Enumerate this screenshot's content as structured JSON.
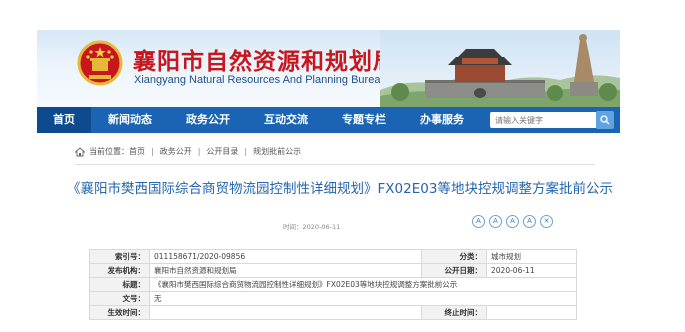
{
  "header": {
    "title": "襄阳市自然资源和规划局",
    "subtitle": "Xiangyang Natural Resources And Planning Bureau"
  },
  "nav": {
    "items": [
      {
        "label": "首页"
      },
      {
        "label": "新闻动态"
      },
      {
        "label": "政务公开"
      },
      {
        "label": "互动交流"
      },
      {
        "label": "专题专栏"
      },
      {
        "label": "办事服务"
      }
    ],
    "search_placeholder": "请输入关键字"
  },
  "breadcrumb": {
    "prefix": "当前位置：",
    "items": [
      "首页",
      "政务公开",
      "公开目录",
      "规划批前公示"
    ]
  },
  "article": {
    "title": "《襄阳市樊西国际综合商贸物流园控制性详细规划》FX02E03等地块控规调整方案批前公示",
    "date": "时间：2020-06-11",
    "tools": [
      "A",
      "A",
      "A",
      "A",
      "✕"
    ]
  },
  "info_table": {
    "rows": [
      {
        "label1": "索引号：",
        "value1": "011158671/2020-09856",
        "label2": "分类：",
        "value2": "城市规划"
      },
      {
        "label1": "发布机构：",
        "value1": "襄阳市自然资源和规划局",
        "label2": "公开日期：",
        "value2": "2020-06-11"
      }
    ],
    "title_label": "标题：",
    "title_value": "《襄阳市樊西国际综合商贸物流园控制性详细规划》FX02E03等地块控规调整方案批前公示",
    "docno_label": "文号：",
    "docno_value": "无",
    "effective_label": "生效时间：",
    "effective_value": "",
    "expire_label": "终止时间：",
    "expire_value": ""
  },
  "colors": {
    "brand_red": "#c8161e",
    "nav_blue": "#1b64b3",
    "title_blue": "#2466ad"
  }
}
